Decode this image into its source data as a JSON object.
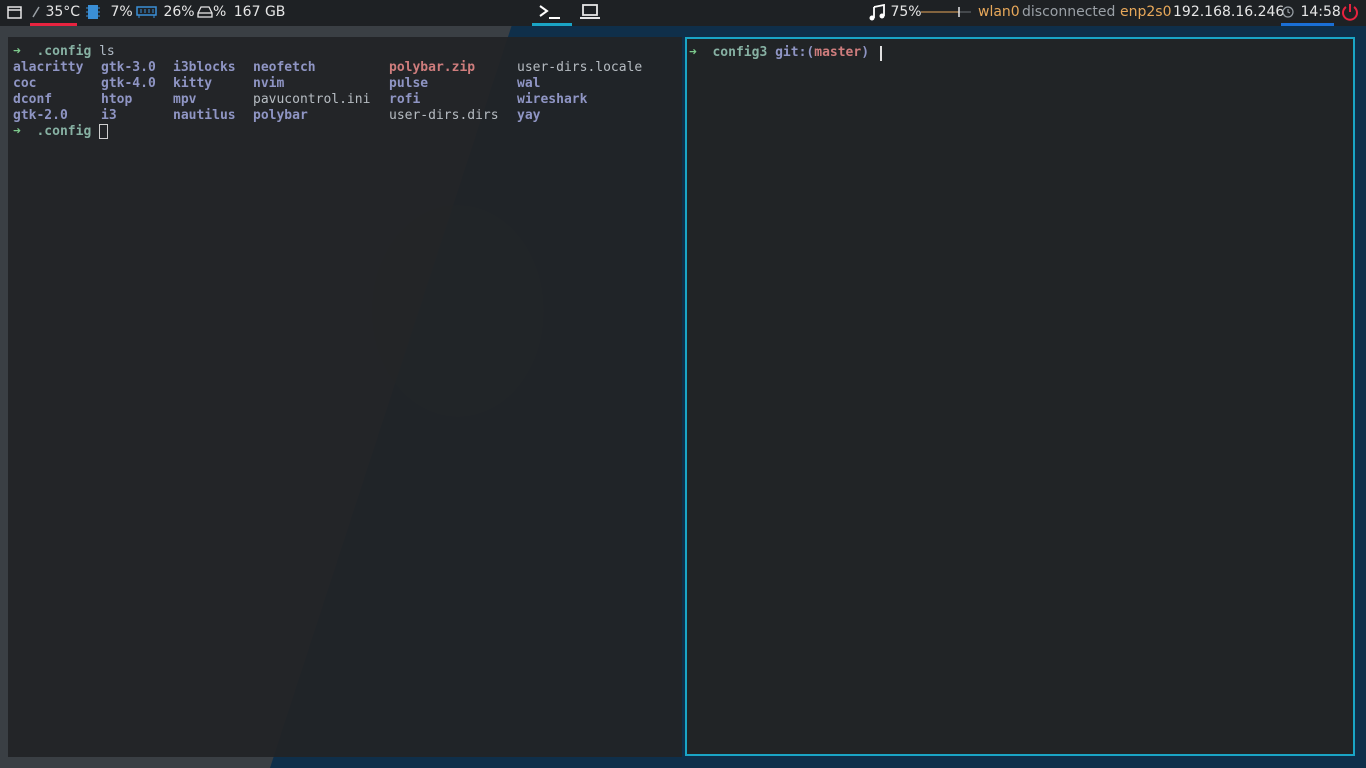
{
  "taskbar": {
    "temperature": "35°C",
    "cpu": "7%",
    "ram": "26%",
    "disk_percent": "%",
    "disk_free": "167 GB",
    "volume": "75%",
    "wlan_iface": "wlan0",
    "wlan_status": "disconnected",
    "eth_iface": "enp2s0",
    "eth_ip": "192.168.16.246",
    "clock": "14:58",
    "volume_level": 0.75
  },
  "colors": {
    "bar_bg": "#1e2124",
    "temp_underline": "#e8233f",
    "workspace_underline": "#1aa5c6",
    "clock_underline": "#1a6fd6",
    "power_red": "#e8233f",
    "wlan_orange": "#e8a85a",
    "focused_border": "#1aa5c6"
  },
  "workspaces": [
    {
      "icon": "terminal-icon",
      "active": true
    },
    {
      "icon": "laptop-icon",
      "active": false
    }
  ],
  "terminal_left": {
    "prompt_dir": ".config",
    "command": "ls",
    "ls_rows": [
      [
        "alacritty",
        "gtk-3.0",
        "i3blocks",
        "neofetch",
        "polybar.zip",
        "user-dirs.locale"
      ],
      [
        "coc",
        "gtk-4.0",
        "kitty",
        "nvim",
        "pulse",
        "wal"
      ],
      [
        "dconf",
        "htop",
        "mpv",
        "pavucontrol.ini",
        "rofi",
        "wireshark"
      ],
      [
        "gtk-2.0",
        "i3",
        "nautilus",
        "polybar",
        "user-dirs.dirs",
        "yay"
      ]
    ],
    "prompt2_dir": ".config"
  },
  "terminal_right": {
    "prompt_dir": "config3",
    "git_label": "git:(",
    "branch": "master",
    "git_close": ")"
  }
}
